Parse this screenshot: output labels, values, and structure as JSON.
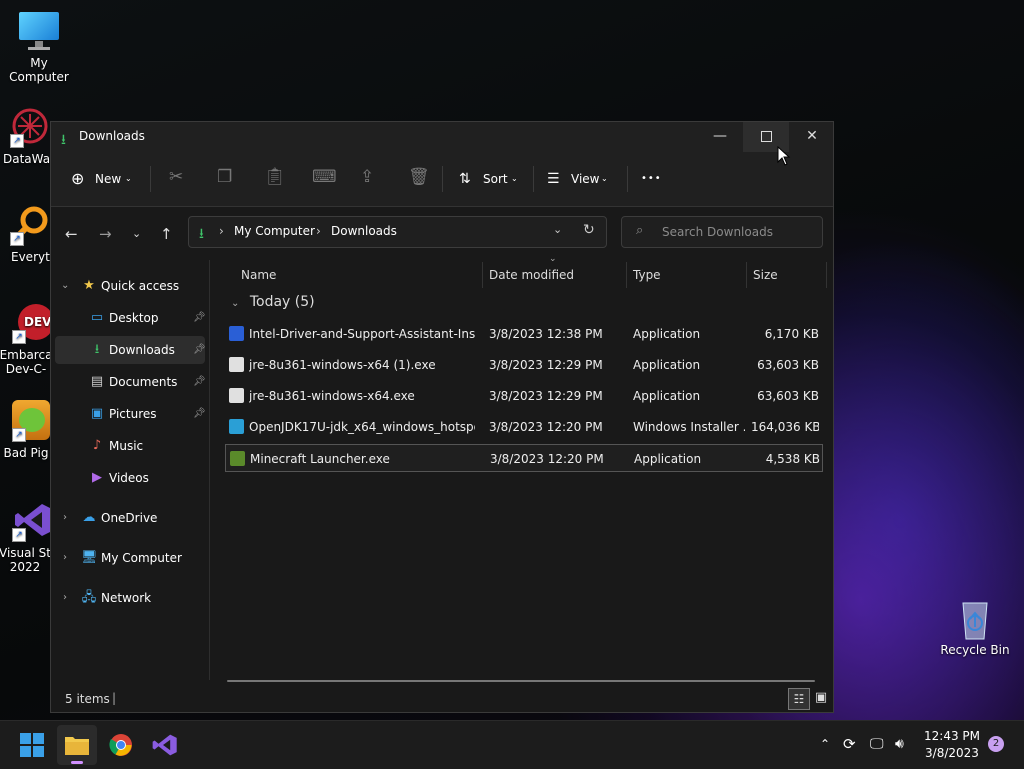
{
  "desktop": {
    "icons": [
      {
        "label": "My Computer"
      },
      {
        "label": "DataWag"
      },
      {
        "label": "Everyth"
      },
      {
        "label": "Embarca Dev-C-"
      },
      {
        "label": "Bad Pig"
      },
      {
        "label": "Visual St 2022"
      },
      {
        "label": "Recycle Bin"
      }
    ]
  },
  "window": {
    "title": "Downloads",
    "toolbar": {
      "new_label": "New",
      "sort_label": "Sort",
      "view_label": "View",
      "more_label": "•••"
    },
    "address": {
      "segments": [
        "My Computer",
        "Downloads"
      ]
    },
    "search": {
      "placeholder": "Search Downloads"
    },
    "sidebar": {
      "quick_access": "Quick access",
      "items": [
        {
          "label": "Desktop",
          "pinned": true
        },
        {
          "label": "Downloads",
          "pinned": true
        },
        {
          "label": "Documents",
          "pinned": true
        },
        {
          "label": "Pictures",
          "pinned": true
        },
        {
          "label": "Music"
        },
        {
          "label": "Videos"
        }
      ],
      "onedrive": "OneDrive",
      "my_computer": "My Computer",
      "network": "Network"
    },
    "columns": {
      "name": "Name",
      "date": "Date modified",
      "type": "Type",
      "size": "Size"
    },
    "group_label": "Today (5)",
    "files": [
      {
        "name": "Intel-Driver-and-Support-Assistant-Instal...",
        "date": "3/8/2023 12:38 PM",
        "type": "Application",
        "size": "6,170 KB"
      },
      {
        "name": "jre-8u361-windows-x64 (1).exe",
        "date": "3/8/2023 12:29 PM",
        "type": "Application",
        "size": "63,603 KB"
      },
      {
        "name": "jre-8u361-windows-x64.exe",
        "date": "3/8/2023 12:29 PM",
        "type": "Application",
        "size": "63,603 KB"
      },
      {
        "name": "OpenJDK17U-jdk_x64_windows_hotspot_...",
        "date": "3/8/2023 12:20 PM",
        "type": "Windows Installer ...",
        "size": "164,036 KB"
      },
      {
        "name": "Minecraft Launcher.exe",
        "date": "3/8/2023 12:20 PM",
        "type": "Application",
        "size": "4,538 KB"
      }
    ],
    "status": {
      "items_count": "5 items"
    }
  },
  "taskbar": {
    "time": "12:43 PM",
    "date": "3/8/2023",
    "notification_count": "2"
  },
  "colors": {
    "accent_green": "#3fc46a",
    "folder_yellow": "#f2c94c",
    "window_bg": "#191919"
  }
}
